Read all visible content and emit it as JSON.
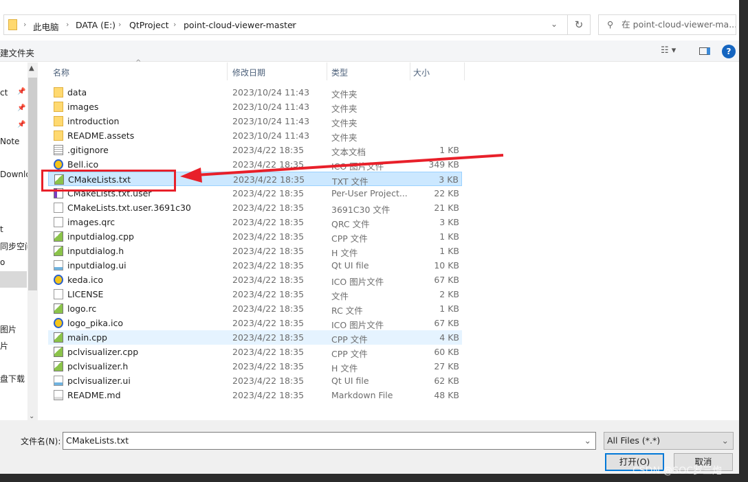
{
  "breadcrumb": [
    "此电脑",
    "DATA (E:)",
    "QtProject",
    "point-cloud-viewer-master"
  ],
  "search": {
    "placeholder": "在 point-cloud-viewer-ma..."
  },
  "toolbar": {
    "new_folder": "建文件夹"
  },
  "sidebar": {
    "items": [
      "ct",
      "Note",
      "Downlo",
      "t",
      "同步空间",
      "o",
      "图片",
      "片",
      "盘下载"
    ]
  },
  "columns": {
    "name": "名称",
    "date": "修改日期",
    "type": "类型",
    "size": "大小"
  },
  "files": [
    {
      "name": "data",
      "date": "2023/10/24 11:43",
      "type": "文件夹",
      "size": "",
      "icon": "folder"
    },
    {
      "name": "images",
      "date": "2023/10/24 11:43",
      "type": "文件夹",
      "size": "",
      "icon": "folder"
    },
    {
      "name": "introduction",
      "date": "2023/10/24 11:43",
      "type": "文件夹",
      "size": "",
      "icon": "folder"
    },
    {
      "name": "README.assets",
      "date": "2023/10/24 11:43",
      "type": "文件夹",
      "size": "",
      "icon": "folder"
    },
    {
      "name": ".gitignore",
      "date": "2023/4/22 18:35",
      "type": "文本文档",
      "size": "1 KB",
      "icon": "text"
    },
    {
      "name": "Bell.ico",
      "date": "2023/4/22 18:35",
      "type": "ICO 图片文件",
      "size": "349 KB",
      "icon": "ico"
    },
    {
      "name": "CMakeLists.txt",
      "date": "2023/4/22 18:35",
      "type": "TXT 文件",
      "size": "3 KB",
      "icon": "notepad"
    },
    {
      "name": "CMakeLists.txt.user",
      "date": "2023/4/22 18:35",
      "type": "Per-User Project...",
      "size": "22 KB",
      "icon": "vs"
    },
    {
      "name": "CMakeLists.txt.user.3691c30",
      "date": "2023/4/22 18:35",
      "type": "3691C30 文件",
      "size": "21 KB",
      "icon": "file"
    },
    {
      "name": "images.qrc",
      "date": "2023/4/22 18:35",
      "type": "QRC 文件",
      "size": "3 KB",
      "icon": "file"
    },
    {
      "name": "inputdialog.cpp",
      "date": "2023/4/22 18:35",
      "type": "CPP 文件",
      "size": "1 KB",
      "icon": "notepad"
    },
    {
      "name": "inputdialog.h",
      "date": "2023/4/22 18:35",
      "type": "H 文件",
      "size": "1 KB",
      "icon": "notepad"
    },
    {
      "name": "inputdialog.ui",
      "date": "2023/4/22 18:35",
      "type": "Qt UI file",
      "size": "10 KB",
      "icon": "ui"
    },
    {
      "name": "keda.ico",
      "date": "2023/4/22 18:35",
      "type": "ICO 图片文件",
      "size": "67 KB",
      "icon": "ico"
    },
    {
      "name": "LICENSE",
      "date": "2023/4/22 18:35",
      "type": "文件",
      "size": "2 KB",
      "icon": "file"
    },
    {
      "name": "logo.rc",
      "date": "2023/4/22 18:35",
      "type": "RC 文件",
      "size": "1 KB",
      "icon": "notepad"
    },
    {
      "name": "logo_pika.ico",
      "date": "2023/4/22 18:35",
      "type": "ICO 图片文件",
      "size": "67 KB",
      "icon": "ico"
    },
    {
      "name": "main.cpp",
      "date": "2023/4/22 18:35",
      "type": "CPP 文件",
      "size": "4 KB",
      "icon": "notepad"
    },
    {
      "name": "pclvisualizer.cpp",
      "date": "2023/4/22 18:35",
      "type": "CPP 文件",
      "size": "60 KB",
      "icon": "notepad"
    },
    {
      "name": "pclvisualizer.h",
      "date": "2023/4/22 18:35",
      "type": "H 文件",
      "size": "27 KB",
      "icon": "notepad"
    },
    {
      "name": "pclvisualizer.ui",
      "date": "2023/4/22 18:35",
      "type": "Qt UI file",
      "size": "62 KB",
      "icon": "ui"
    },
    {
      "name": "README.md",
      "date": "2023/4/22 18:35",
      "type": "Markdown File",
      "size": "48 KB",
      "icon": "md"
    }
  ],
  "selected_file": "CMakeLists.txt",
  "hovered_file": "main.cpp",
  "footer": {
    "filename_label": "文件名(N):",
    "filename_value": "CMakeLists.txt",
    "filetype": "All Files (*.*)",
    "open": "打开(O)",
    "cancel": "取消"
  },
  "watermark": "CSDN @SOC罗三炮",
  "colors": {
    "selection": "#cce8ff",
    "annotation": "#e8202a",
    "accent": "#0078d7"
  }
}
